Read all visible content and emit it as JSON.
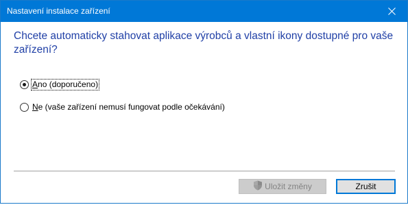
{
  "window": {
    "title": "Nastavení instalace zařízení",
    "accent_color": "#0078d7"
  },
  "titlebar": {
    "close_icon": "close-icon"
  },
  "main": {
    "question": "Chcete automaticky stahovat aplikace výrobců a vlastní ikony dostupné pro vaše zařízení?",
    "options": [
      {
        "accel": "A",
        "label_rest": "no (doporučeno)",
        "selected": true
      },
      {
        "accel": "N",
        "label_rest": "e (vaše zařízení nemusí fungovat podle očekávání)",
        "selected": false
      }
    ]
  },
  "buttons": {
    "save_label": "Uložit změny",
    "save_enabled": false,
    "save_icon": "uac-shield-icon",
    "cancel_label": "Zrušit"
  }
}
